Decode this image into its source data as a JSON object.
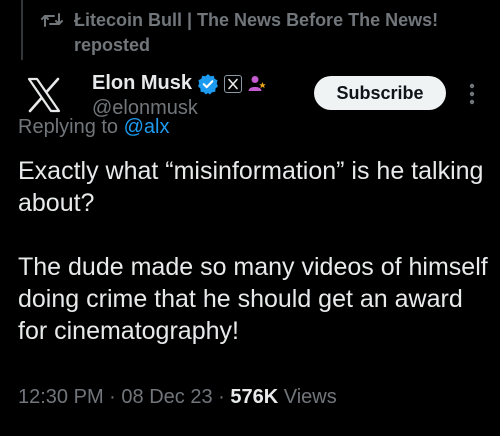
{
  "repost": {
    "text": "Łitecoin Bull | The News Before The News! reposted"
  },
  "author": {
    "display_name": "Elon Musk",
    "handle": "@elonmusk",
    "verified_color": "#1d9bf0",
    "affiliate_color": "#c45bcf",
    "avatar_icon": "x-logo-icon"
  },
  "actions": {
    "subscribe_label": "Subscribe"
  },
  "reply": {
    "prefix": "Replying to",
    "target": "@alx"
  },
  "tweet": {
    "paragraph_1": "Exactly what “misinformation” is he talking about?",
    "paragraph_2": "The dude made so many videos of himself doing crime that he should get an award for cinematography!"
  },
  "meta": {
    "time": "12:30 PM",
    "separator": " · ",
    "date": "08 Dec 23",
    "views_count": "576K",
    "views_label": " Views"
  },
  "colors": {
    "background": "#000000",
    "primary_text": "#e7e9ea",
    "secondary_text": "#71767b",
    "link": "#1d9bf0"
  }
}
